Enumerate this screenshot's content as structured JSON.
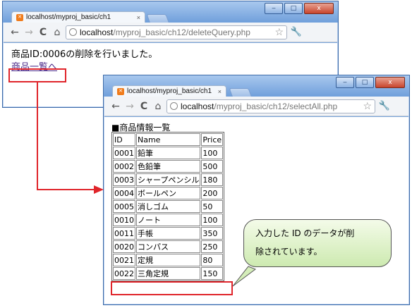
{
  "back_window": {
    "tab_title": "localhost/myproj_basic/ch1",
    "url_host": "localhost",
    "url_path": "/myproj_basic/ch12/deleteQuery.php",
    "message": "商品ID:0006の削除を行いました。",
    "link_text": "商品一覧へ"
  },
  "front_window": {
    "tab_title": "localhost/myproj_basic/ch1",
    "url_host": "localhost",
    "url_path": "/myproj_basic/ch12/selectAll.php",
    "page_title": "■商品情報一覧",
    "table": {
      "headers": [
        "ID",
        "Name",
        "Price"
      ],
      "rows": [
        [
          "0001",
          "鉛筆",
          "100"
        ],
        [
          "0002",
          "色鉛筆",
          "500"
        ],
        [
          "0003",
          "シャープペンシル",
          "180"
        ],
        [
          "0004",
          "ボールペン",
          "200"
        ],
        [
          "0005",
          "消しゴム",
          "50"
        ],
        [
          "0010",
          "ノート",
          "100"
        ],
        [
          "0011",
          "手帳",
          "350"
        ],
        [
          "0020",
          "コンパス",
          "250"
        ],
        [
          "0021",
          "定規",
          "80"
        ],
        [
          "0022",
          "三角定規",
          "150"
        ]
      ]
    }
  },
  "callout": {
    "line1": "入力した ID のデータが削",
    "line2": "除されています。"
  },
  "glyphs": {
    "minimize": "‒",
    "maximize": "□",
    "close": "x",
    "tab_close": "×",
    "back": "←",
    "forward": "→",
    "reload": "C",
    "home": "⌂",
    "star": "☆",
    "wrench": "🔧"
  },
  "colors": {
    "annotation_red": "#e0252b",
    "link_purple": "#4b2a8a"
  }
}
